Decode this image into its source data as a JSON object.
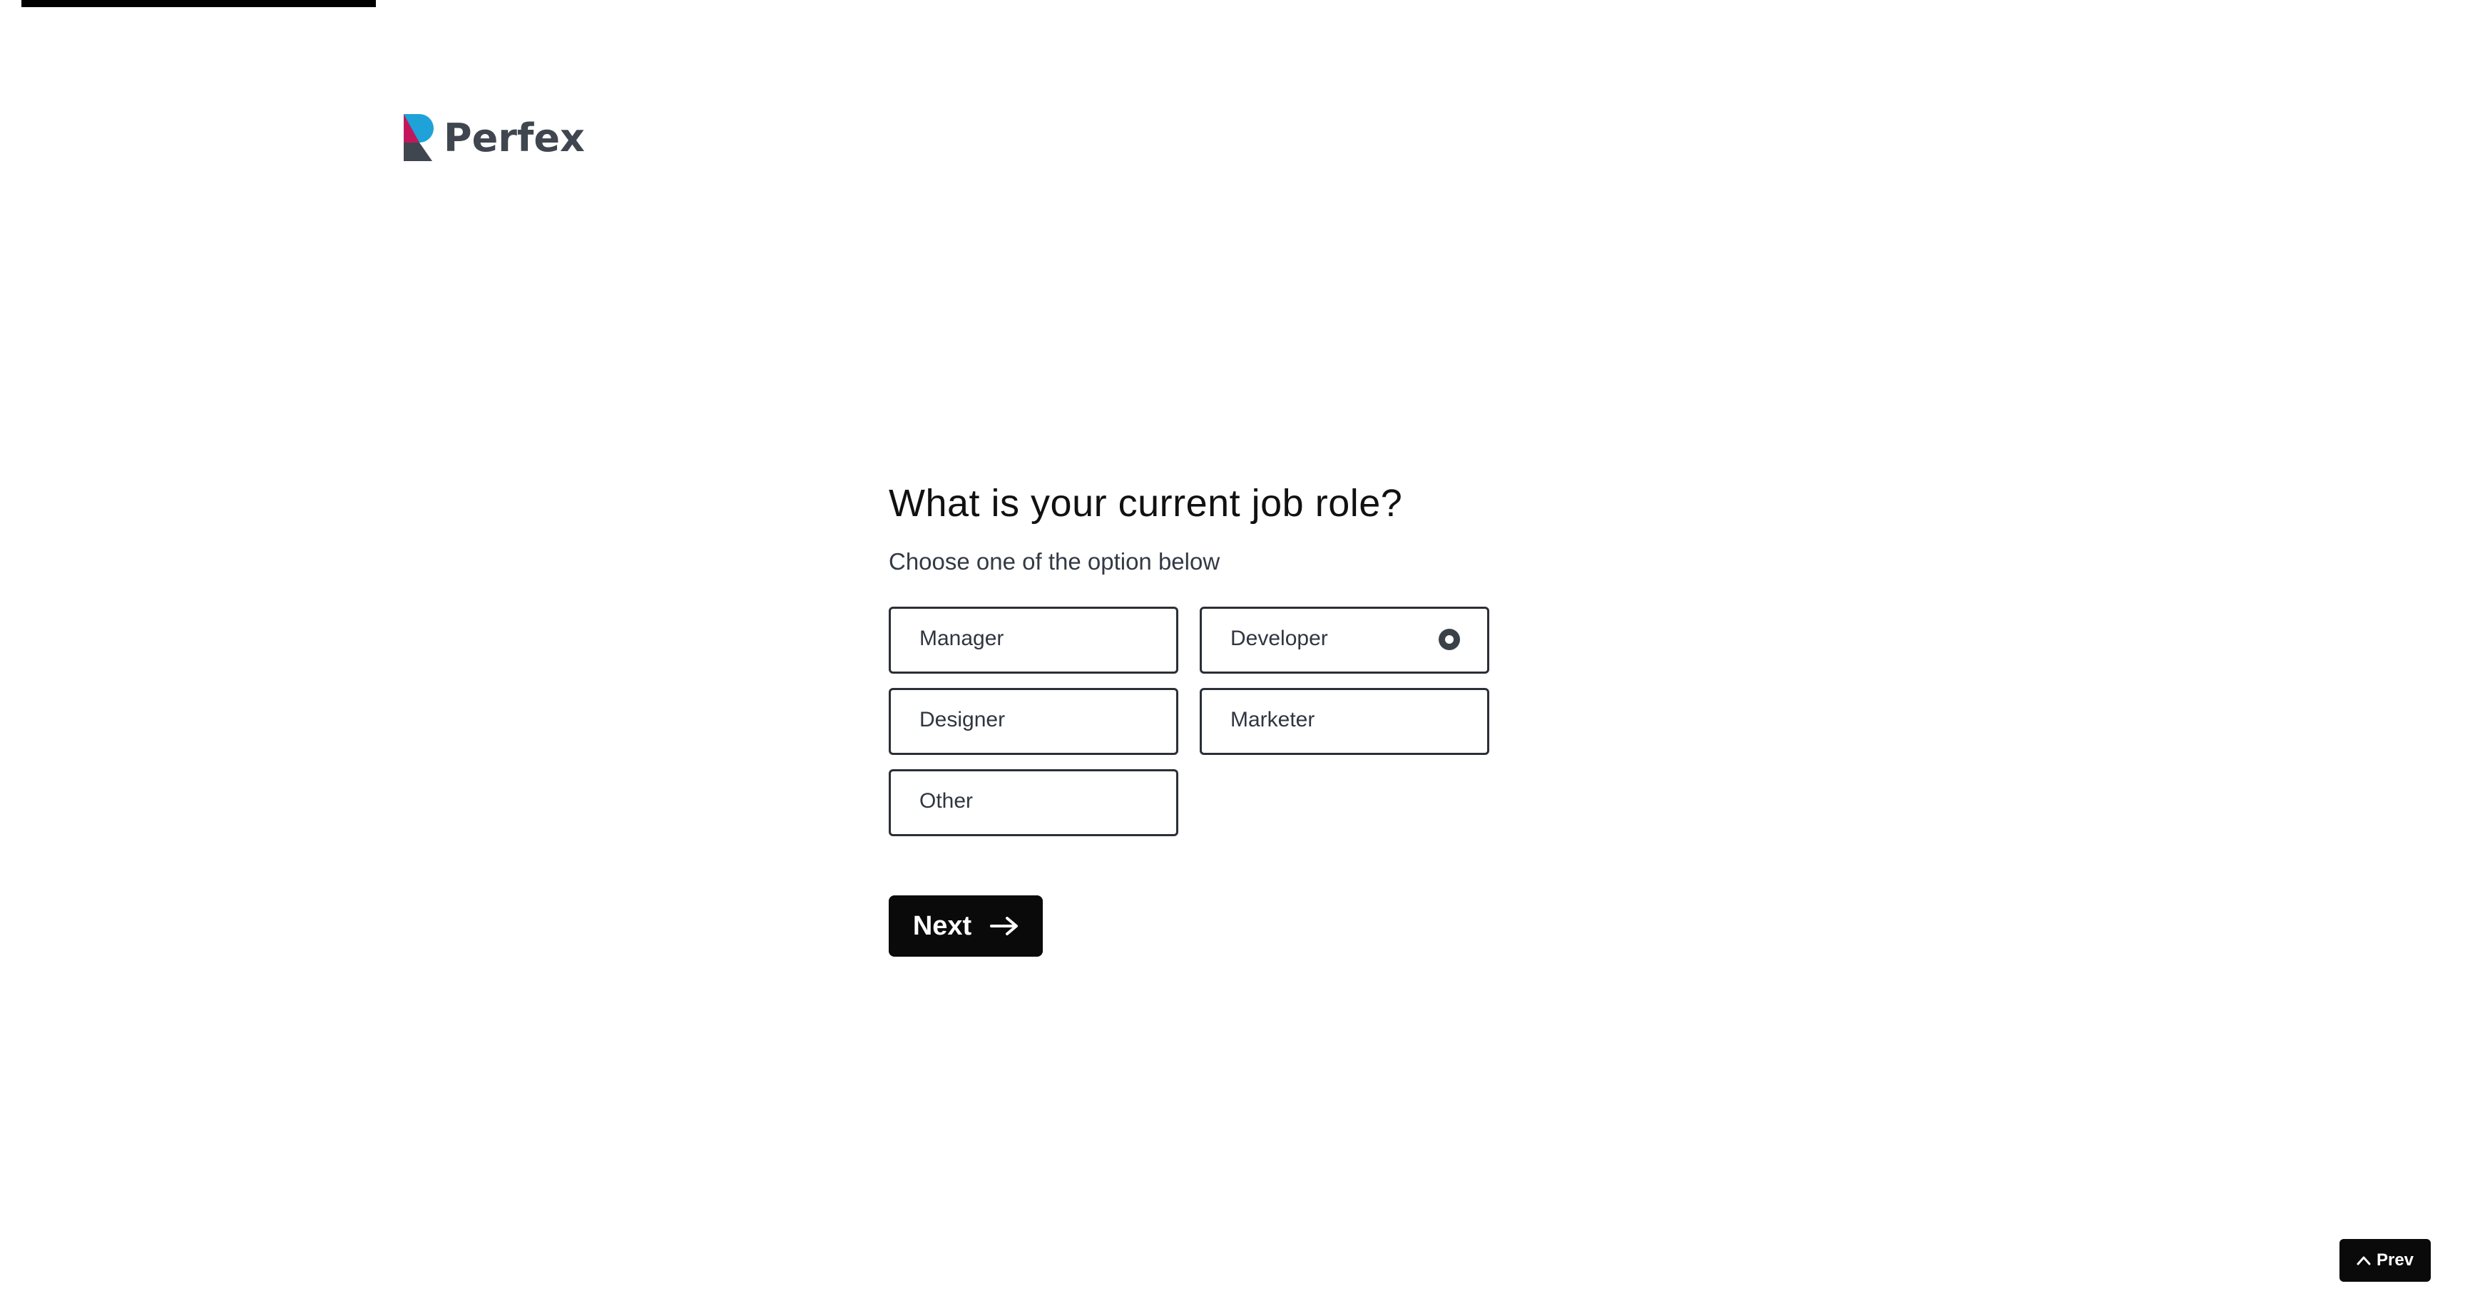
{
  "progress": {
    "fraction": 0.145
  },
  "logo": {
    "text": "Perfex",
    "colors": {
      "blue": "#1fa2d8",
      "magenta": "#c2185b",
      "dark": "#3f4650"
    }
  },
  "question": {
    "title": "What is your current job role?",
    "subtitle": "Choose one of the option below"
  },
  "options": [
    {
      "label": "Manager",
      "selected": false
    },
    {
      "label": "Developer",
      "selected": true
    },
    {
      "label": "Designer",
      "selected": false
    },
    {
      "label": "Marketer",
      "selected": false
    },
    {
      "label": "Other",
      "selected": false
    }
  ],
  "buttons": {
    "next_label": "Next",
    "next_icon": "arrow-right-icon",
    "prev_label": "Prev",
    "prev_icon": "chevron-up-icon"
  },
  "colors": {
    "primary": "#0a0a0a",
    "option_border": "#2b2f36",
    "option_text": "#2f3640"
  }
}
